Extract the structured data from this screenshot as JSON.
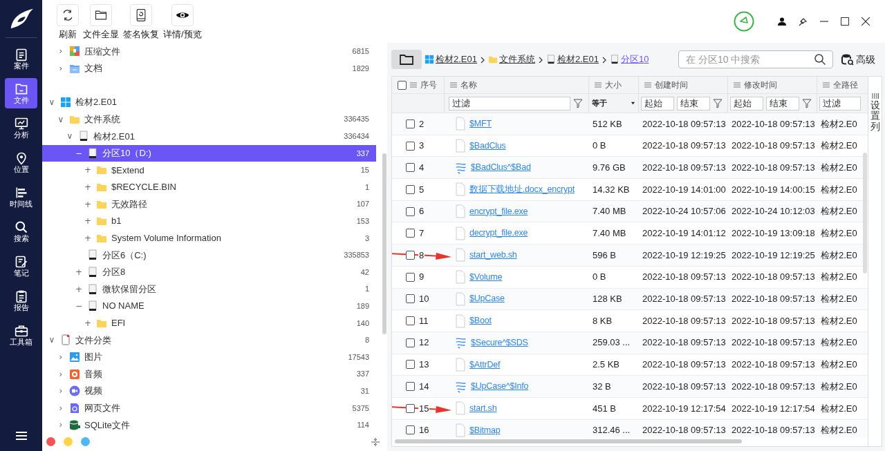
{
  "nav": [
    {
      "label": "案件",
      "selected": false
    },
    {
      "label": "文件",
      "selected": true
    },
    {
      "label": "分析",
      "selected": false
    },
    {
      "label": "位置",
      "selected": false
    },
    {
      "label": "时间线",
      "selected": false
    },
    {
      "label": "搜索",
      "selected": false
    },
    {
      "label": "笔记",
      "selected": false
    },
    {
      "label": "报告",
      "selected": false
    },
    {
      "label": "工具箱",
      "selected": false
    }
  ],
  "toolbar": [
    {
      "label": "刷新"
    },
    {
      "label": "文件全显"
    },
    {
      "label": "签名恢复"
    },
    {
      "label": "详情/预览"
    }
  ],
  "tree": [
    {
      "children": [
        {
          "label": "压缩文件",
          "count": "6815",
          "kind": "archive",
          "expander": "›",
          "selected": false
        },
        {
          "label": "文档",
          "count": "1829",
          "kind": "document",
          "expander": "›",
          "selected": false
        }
      ]
    },
    {
      "label": "检材2.E01",
      "kind": "windows",
      "expander": "∨",
      "selected": false,
      "children": [
        {
          "label": "文件系统",
          "count": "336435",
          "kind": "folder",
          "expander": "∨",
          "selected": false,
          "children": [
            {
              "label": "检材2.E01",
              "count": "336434",
              "kind": "drive",
              "expander": "∨",
              "selected": false,
              "children": [
                {
                  "label": "分区10（D:)",
                  "count": "337",
                  "kind": "drive",
                  "expander": "−",
                  "selected": true,
                  "children": [
                    {
                      "label": "$Extend",
                      "count": "15",
                      "kind": "folder",
                      "expander": "+",
                      "selected": false
                    },
                    {
                      "label": "$RECYCLE.BIN",
                      "count": "1",
                      "kind": "folder",
                      "expander": "+",
                      "selected": false
                    },
                    {
                      "label": "无效路径",
                      "count": "107",
                      "kind": "folder",
                      "expander": "+",
                      "selected": false
                    },
                    {
                      "label": "b1",
                      "count": "153",
                      "kind": "folder",
                      "expander": "+",
                      "selected": false
                    },
                    {
                      "label": "System Volume Information",
                      "count": "3",
                      "kind": "folder",
                      "expander": "+",
                      "selected": false
                    }
                  ]
                },
                {
                  "label": "分区6（C:)",
                  "count": "335853",
                  "kind": "drive",
                  "selected": false
                },
                {
                  "label": "分区8",
                  "count": "42",
                  "kind": "drive",
                  "expander": "+",
                  "selected": false
                },
                {
                  "label": "微软保留分区",
                  "count": "1",
                  "kind": "drive",
                  "expander": "+",
                  "selected": false
                },
                {
                  "label": "NO NAME",
                  "count": "189",
                  "kind": "drive",
                  "expander": "−",
                  "selected": false,
                  "children": [
                    {
                      "label": "EFI",
                      "count": "140",
                      "kind": "folder",
                      "expander": "+",
                      "selected": false
                    }
                  ]
                }
              ]
            }
          ]
        }
      ]
    },
    {
      "label": "文件分类",
      "count": "8",
      "kind": "category",
      "expander": "∨",
      "selected": false,
      "children": [
        {
          "label": "图片",
          "count": "17543",
          "kind": "image",
          "expander": "›",
          "selected": false
        },
        {
          "label": "音频",
          "count": "337",
          "kind": "audio",
          "expander": "›",
          "selected": false
        },
        {
          "label": "视频",
          "count": "31",
          "kind": "video",
          "expander": "›",
          "selected": false
        },
        {
          "label": "网页文件",
          "count": "5375",
          "kind": "web",
          "expander": "›",
          "selected": false
        },
        {
          "label": "SQLite文件",
          "count": "114",
          "kind": "sqlite",
          "expander": "›",
          "selected": false
        }
      ]
    }
  ],
  "status_dots": [
    {
      "color": "#f25555"
    },
    {
      "color": "#fdd34a"
    },
    {
      "color": "#55b6f5"
    }
  ],
  "breadcrumb": [
    {
      "label": "检材2.E01",
      "kind": "windows",
      "selected": false
    },
    {
      "label": "文件系统",
      "kind": "folder",
      "selected": false
    },
    {
      "label": "检材2.E01",
      "kind": "drive",
      "selected": false
    },
    {
      "label": "分区10",
      "kind": "drive",
      "selected": true
    }
  ],
  "search": {
    "placeholder": "在 分区10 中搜索"
  },
  "advanced_button": "高级",
  "table": {
    "select_all_checked": false,
    "columns": [
      "序号",
      "名称",
      "大小",
      "创建时间",
      "修改时间",
      "全路径"
    ],
    "filters": {
      "name": {
        "placeholder": "过滤"
      },
      "size": "等于",
      "created_start": {
        "placeholder": "起始"
      },
      "created_end": {
        "placeholder": "结束"
      },
      "modified_start": {
        "placeholder": "起始"
      },
      "modified_end": {
        "placeholder": "结束"
      },
      "path": {
        "placeholder": "过滤"
      }
    },
    "column_settings": "设置列",
    "rows": [
      {
        "index": "2",
        "name": "$MFT",
        "kind": "file",
        "size": "512 KB",
        "created": "2022-10-18 09:57:13",
        "modified": "2022-10-18 09:57:13",
        "path": "检材2.E0",
        "checked": false,
        "arrow_marked": false
      },
      {
        "index": "3",
        "name": "$BadClus",
        "kind": "file",
        "size": "0 B",
        "created": "2022-10-18 09:57:13",
        "modified": "2022-10-18 09:57:13",
        "path": "检材2.E0",
        "checked": false,
        "arrow_marked": false
      },
      {
        "index": "4",
        "name": "$BadClus^$Bad",
        "kind": "stream",
        "size": "9.76 GB",
        "created": "2022-10-18 09:57:13",
        "modified": "2022-10-18 09:57:13",
        "path": "检材2.E0",
        "checked": false,
        "arrow_marked": false
      },
      {
        "index": "5",
        "name": "数据下载地址.docx_encrypt",
        "kind": "file",
        "size": "14.32 KB",
        "created": "2022-10-19 14:01:00",
        "modified": "2022-10-19 14:00:15",
        "path": "检材2.E0",
        "checked": false,
        "arrow_marked": false
      },
      {
        "index": "6",
        "name": "encrypt_file.exe",
        "kind": "file",
        "size": "7.40 MB",
        "created": "2022-10-24 10:57:06",
        "modified": "2022-10-24 10:12:03",
        "path": "检材2.E0",
        "checked": false,
        "arrow_marked": false
      },
      {
        "index": "7",
        "name": "decrypt_file.exe",
        "kind": "file",
        "size": "7.40 MB",
        "created": "2022-10-19 14:01:12",
        "modified": "2022-10-19 13:09:18",
        "path": "检材2.E0",
        "checked": false,
        "arrow_marked": false
      },
      {
        "index": "8",
        "name": "start_web.sh",
        "kind": "file",
        "size": "596 B",
        "created": "2022-10-19 12:19:25",
        "modified": "2022-10-19 12:19:25",
        "path": "检材2.E0",
        "checked": false,
        "arrow_marked": true
      },
      {
        "index": "9",
        "name": "$Volume",
        "kind": "file",
        "size": "0 B",
        "created": "2022-10-18 09:57:13",
        "modified": "2022-10-18 09:57:13",
        "path": "检材2.E0",
        "checked": false,
        "arrow_marked": false
      },
      {
        "index": "10",
        "name": "$UpCase",
        "kind": "file",
        "size": "128 KB",
        "created": "2022-10-18 09:57:13",
        "modified": "2022-10-18 09:57:13",
        "path": "检材2.E0",
        "checked": false,
        "arrow_marked": false
      },
      {
        "index": "11",
        "name": "$Boot",
        "kind": "file",
        "size": "8 KB",
        "created": "2022-10-18 09:57:13",
        "modified": "2022-10-18 09:57:13",
        "path": "检材2.E0",
        "checked": false,
        "arrow_marked": false
      },
      {
        "index": "12",
        "name": "$Secure^$SDS",
        "kind": "stream",
        "size": "259.03 ...",
        "created": "2022-10-18 09:57:13",
        "modified": "2022-10-18 09:57:13",
        "path": "检材2.E0",
        "checked": false,
        "arrow_marked": false
      },
      {
        "index": "13",
        "name": "$AttrDef",
        "kind": "file",
        "size": "2.5 KB",
        "created": "2022-10-18 09:57:13",
        "modified": "2022-10-18 09:57:13",
        "path": "检材2.E0",
        "checked": false,
        "arrow_marked": false
      },
      {
        "index": "14",
        "name": "$UpCase^$Info",
        "kind": "stream",
        "size": "32 B",
        "created": "2022-10-18 09:57:13",
        "modified": "2022-10-18 09:57:13",
        "path": "检材2.E0",
        "checked": false,
        "arrow_marked": false
      },
      {
        "index": "15",
        "name": "start.sh",
        "kind": "file",
        "size": "451 B",
        "created": "2022-10-19 12:17:54",
        "modified": "2022-10-19 12:17:54",
        "path": "检材2.E0",
        "checked": false,
        "arrow_marked": true
      },
      {
        "index": "16",
        "name": "$Bitmap",
        "kind": "file",
        "size": "312.46 ...",
        "created": "2022-10-18 09:57:13",
        "modified": "2022-10-18 09:57:13",
        "path": "检材2.E0",
        "checked": false,
        "arrow_marked": false
      }
    ]
  }
}
